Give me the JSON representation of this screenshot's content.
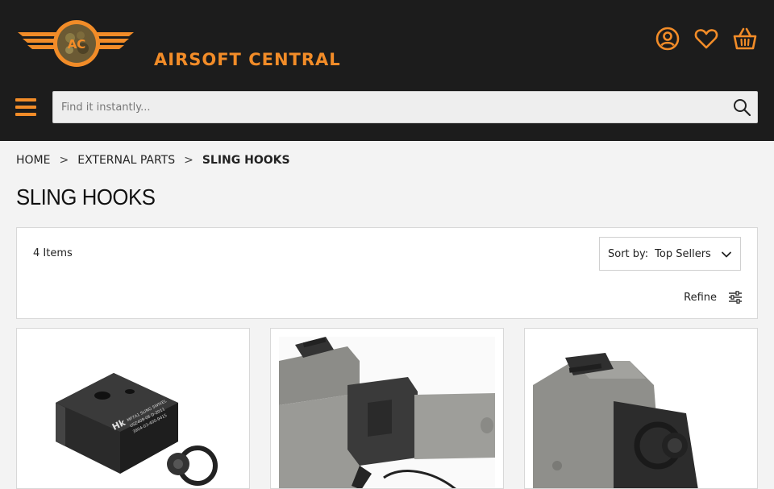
{
  "brand": {
    "name": "AIRSOFT CENTRAL",
    "emblem": "AC",
    "accent_color": "#f28c28",
    "header_bg": "#1c1c1c"
  },
  "header_icons": [
    "account-icon",
    "wishlist-heart-icon",
    "cart-basket-icon"
  ],
  "search": {
    "placeholder": "Find it instantly..."
  },
  "breadcrumb": {
    "items": [
      "HOME",
      "EXTERNAL PARTS",
      "SLING HOOKS"
    ],
    "separator": ">"
  },
  "page_title": "SLING HOOKS",
  "toolbar": {
    "item_count": "4 Items",
    "sort_label": "Sort by:",
    "sort_value": "Top Sellers",
    "refine_label": "Refine"
  },
  "products": [
    {
      "image": "mp7a1-sling-swivel",
      "engraving": [
        "Hk",
        "MP7A1 SLING SWIVEL",
        "USZ408-06 D-2011",
        "3904-03-400-9415"
      ]
    },
    {
      "image": "gray-receiver-sling-hook"
    },
    {
      "image": "gray-sling-hook-mount"
    }
  ]
}
